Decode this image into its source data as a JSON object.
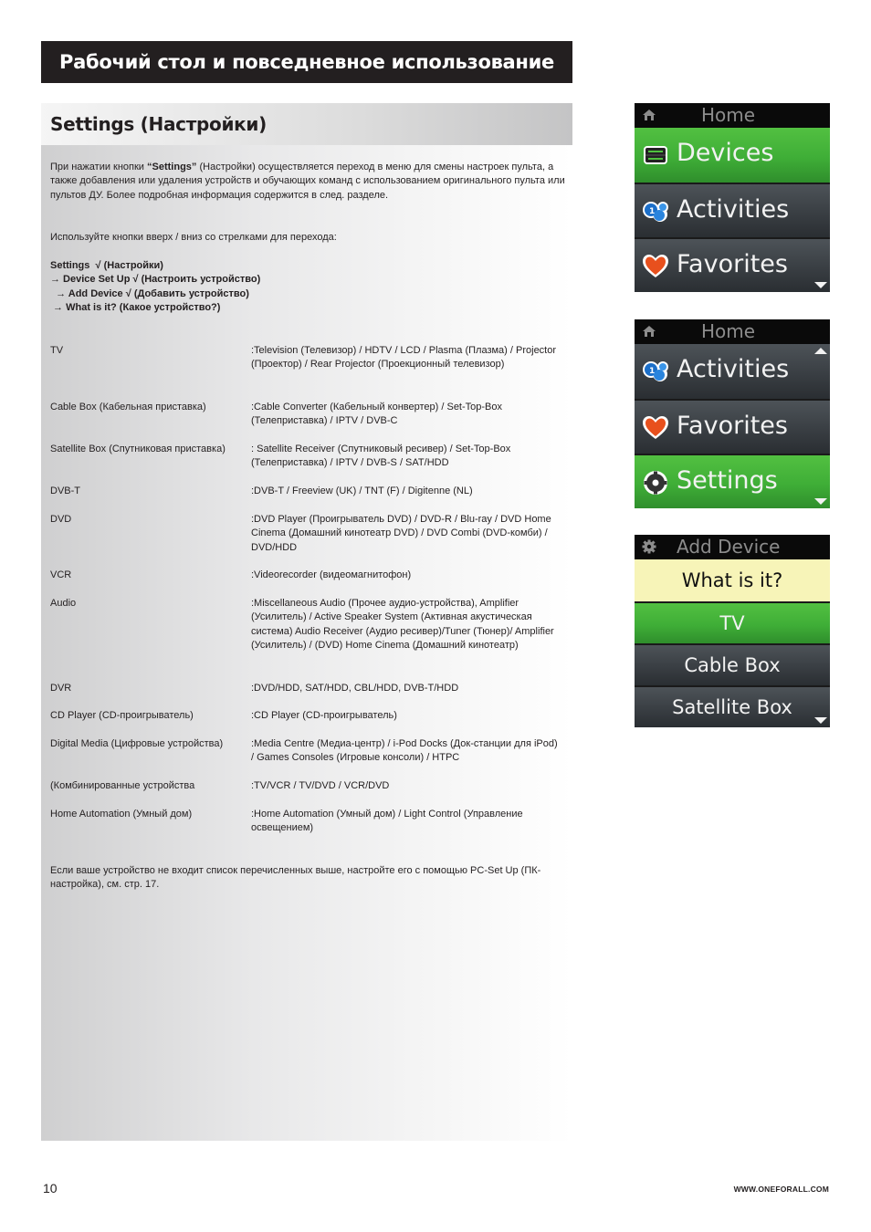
{
  "banner": {
    "title": "Рабочий стол и повседневное использование"
  },
  "section": {
    "title": "Settings (Настройки)"
  },
  "intro": {
    "prefix": "При нажатии кнопки ",
    "bold": "“Settings”",
    "suffix": " (Настройки) осуществляется переход в меню для смены настроек пульта, а также добавления или удаления устройств и обучающих команд с использованием оригинального пульта или пультов ДУ. Более подробная информация содержится в след. разделе."
  },
  "nav_hint": "Используйте кнопки вверх / вниз со стрелками для перехода:",
  "path": [
    "Settings  √ (Настройки)",
    "→ Device Set Up √ (Настроить устройство)",
    "  → Add Device √ (Добавить устройство)",
    " → What is it? (Какое устройство?)"
  ],
  "devices": [
    {
      "label": "TV",
      "value": ":Television (Телевизор) / HDTV / LCD / Plasma (Плазма) / Projector  (Проектор) / Rear Projector (Проекционный телевизор)"
    },
    {
      "label": "Cable Box (Кабельная приставка)",
      "value": ":Cable Converter (Кабельный конвертер) / Set-Top-Box (Телеприставка) / IPTV / DVB-C"
    },
    {
      "label": "Satellite Box (Спутниковая приставка)",
      "value": ": Satellite Receiver (Спутниковый ресивер) / Set-Top-Box (Телеприставка) / IPTV / DVB-S / SAT/HDD"
    },
    {
      "label": "DVB-T",
      "value": ":DVB-T / Freeview (UK) / TNT (F) / Digitenne (NL)"
    },
    {
      "label": "DVD",
      "value": ":DVD Player (Проигрыватель DVD) / DVD-R / Blu-ray / DVD Home Cinema (Домашний кинотеатр DVD) / DVD Combi (DVD-комби) / DVD/HDD"
    },
    {
      "label": "VCR",
      "value": ":Videorecorder (видеомагнитофон)"
    },
    {
      "label": "Audio",
      "value": ":Miscellaneous Audio (Прочее аудио-устройства), Amplifier (Усилитель) / Active Speaker System (Активная акустическая система) Audio Receiver (Аудио ресивер)/Tuner (Тюнер)/ Amplifier (Усилитель) / (DVD) Home Cinema (Домашний кинотеатр)"
    },
    {
      "label": "DVR",
      "value": ":DVD/HDD, SAT/HDD, CBL/HDD, DVB-T/HDD"
    },
    {
      "label": "CD Player (CD-проигрыватель)",
      "value": ":CD Player (CD-проигрыватель)"
    },
    {
      "label": "Digital Media (Цифровые устройства)",
      "value": ":Media Centre (Медиа-центр) / i-Pod Docks (Док-станции для iPod) / Games Consoles (Игровые консоли) / HTPC"
    },
    {
      "label": "(Комбинированные устройства",
      "value": ":TV/VCR / TV/DVD / VCR/DVD"
    },
    {
      "label": "Home Automation (Умный дом)",
      "value": ":Home Automation (Умный дом) / Light Control (Управление освещением)"
    }
  ],
  "footer_note": "Если ваше устройство не входит список перечисленных выше, настройте его с помощью PC-Set Up (ПК-настройка), см. стр. 17.",
  "page_number": "10",
  "website": "WWW.ONEFORALL.COM",
  "screens": [
    {
      "title": "Home",
      "title_icon": "home-icon",
      "items": [
        {
          "label": "Devices",
          "icon": "devices-icon",
          "selected": true
        },
        {
          "label": "Activities",
          "icon": "activities-icon",
          "selected": false
        },
        {
          "label": "Favorites",
          "icon": "heart-icon",
          "selected": false
        }
      ]
    },
    {
      "title": "Home",
      "title_icon": "home-icon",
      "items": [
        {
          "label": "Activities",
          "icon": "activities-icon",
          "selected": false
        },
        {
          "label": "Favorites",
          "icon": "heart-icon",
          "selected": false
        },
        {
          "label": "Settings",
          "icon": "gear-icon",
          "selected": true
        }
      ]
    },
    {
      "title": "Add Device",
      "title_icon": "gear-icon",
      "prompt": "What is it?",
      "items": [
        {
          "label": "TV",
          "selected": true
        },
        {
          "label": "Cable Box",
          "selected": false
        },
        {
          "label": "Satellite Box",
          "selected": false
        }
      ]
    }
  ],
  "colors": {
    "selected_green": "#3fae37",
    "prompt_yellow": "#f7f4b8",
    "banner_dark": "#231f20"
  }
}
